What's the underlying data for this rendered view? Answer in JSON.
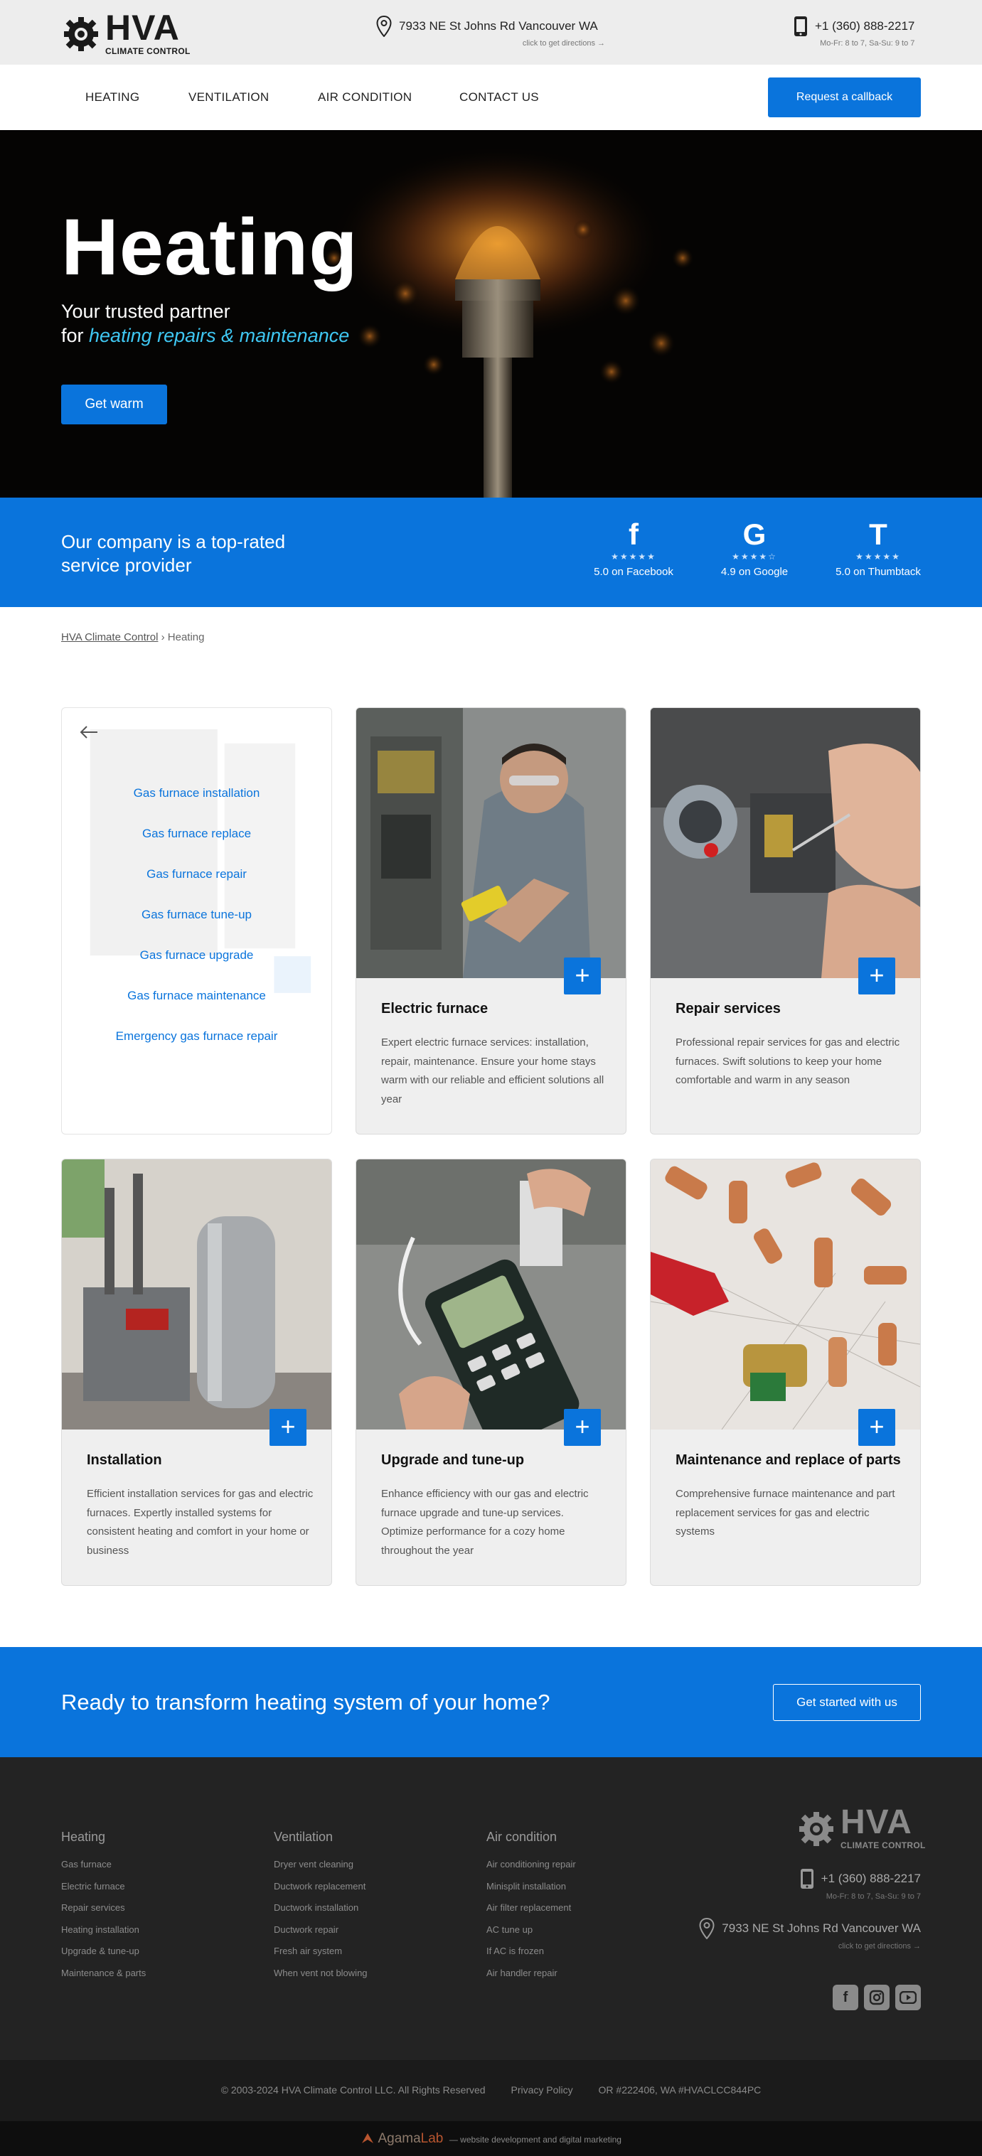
{
  "header": {
    "logo_name": "HVA",
    "logo_sub": "CLIMATE CONTROL",
    "address": "7933 NE St Johns Rd Vancouver WA",
    "address_hint": "click to get directions →",
    "phone": "+1 (360) 888-2217",
    "hours": "Mo-Fr: 8 to 7, Sa-Su: 9 to 7"
  },
  "nav": {
    "items": [
      "HEATING",
      "VENTILATION",
      "AIR CONDITION",
      "CONTACT US"
    ],
    "cta": "Request a callback"
  },
  "hero": {
    "title": "Heating",
    "line1": "Your trusted partner",
    "line2_prefix": "for ",
    "line2_accent": "heating repairs & maintenance",
    "button": "Get warm"
  },
  "rating": {
    "text": "Our company is a top-rated service provider",
    "items": [
      {
        "icon": "facebook-icon",
        "glyph": "f",
        "stars": "★★★★★",
        "label": "5.0 on Facebook"
      },
      {
        "icon": "google-icon",
        "glyph": "G",
        "stars": "★★★★☆",
        "label": "4.9 on Google"
      },
      {
        "icon": "thumbtack-icon",
        "glyph": "T",
        "stars": "★★★★★",
        "label": "5.0 on Thumbtack"
      }
    ]
  },
  "breadcrumb": {
    "home": "HVA Climate Control",
    "sep": "›",
    "current": "Heating"
  },
  "menu": {
    "items": [
      "Gas furnace installation",
      "Gas furnace replace",
      "Gas furnace repair",
      "Gas furnace tune-up",
      "Gas furnace upgrade",
      "Gas furnace maintenance",
      "Emergency gas furnace repair"
    ]
  },
  "cards": [
    {
      "title": "Electric furnace",
      "desc": "Expert electric furnace services: installation, repair, maintenance. Ensure your home stays warm with our reliable and efficient solutions all year"
    },
    {
      "title": "Repair services",
      "desc": "Professional repair services for gas and electric furnaces. Swift solutions to keep your home comfortable and warm in any season"
    },
    {
      "title": "Installation",
      "desc": "Efficient installation services for gas and electric furnaces. Expertly installed systems for consistent heating and comfort in your home or business"
    },
    {
      "title": "Upgrade and tune-up",
      "desc": "Enhance efficiency with our gas and electric furnace upgrade and tune-up services. Optimize performance for a cozy home throughout the year"
    },
    {
      "title": "Maintenance and replace of parts",
      "desc": "Comprehensive furnace maintenance and part replacement services for gas and electric systems"
    }
  ],
  "cta_band": {
    "text": "Ready to transform heating system of your home?",
    "button": "Get started with us"
  },
  "footer": {
    "columns": [
      {
        "title": "Heating",
        "links": [
          "Gas furnace",
          "Electric furnace",
          "Repair services",
          "Heating installation",
          "Upgrade & tune-up",
          "Maintenance & parts"
        ]
      },
      {
        "title": "Ventilation",
        "links": [
          "Dryer vent cleaning",
          "Ductwork replacement",
          "Ductwork installation",
          "Ductwork repair",
          "Fresh air system",
          "When vent not blowing"
        ]
      },
      {
        "title": "Air condition",
        "links": [
          "Air conditioning repair",
          "Minisplit installation",
          "Air filter replacement",
          "AC tune up",
          "If AC is frozen",
          "Air handler repair"
        ]
      }
    ],
    "phone": "+1 (360) 888-2217",
    "hours": "Mo-Fr: 8 to 7, Sa-Su: 9 to 7",
    "address": "7933 NE St Johns Rd Vancouver WA",
    "address_hint": "click to get directions →",
    "copyright": "© 2003-2024 HVA Climate Control LLC. All Rights Reserved",
    "privacy": "Privacy Policy",
    "license": "OR #222406, WA #HVACLCC844PC",
    "dev_name_1": "Agama",
    "dev_name_2": "Lab",
    "dev_tag": "— website development and digital marketing"
  },
  "colors": {
    "accent": "#0a74dc",
    "accent_light": "#3fc7f2",
    "footer_bg": "#232323"
  }
}
